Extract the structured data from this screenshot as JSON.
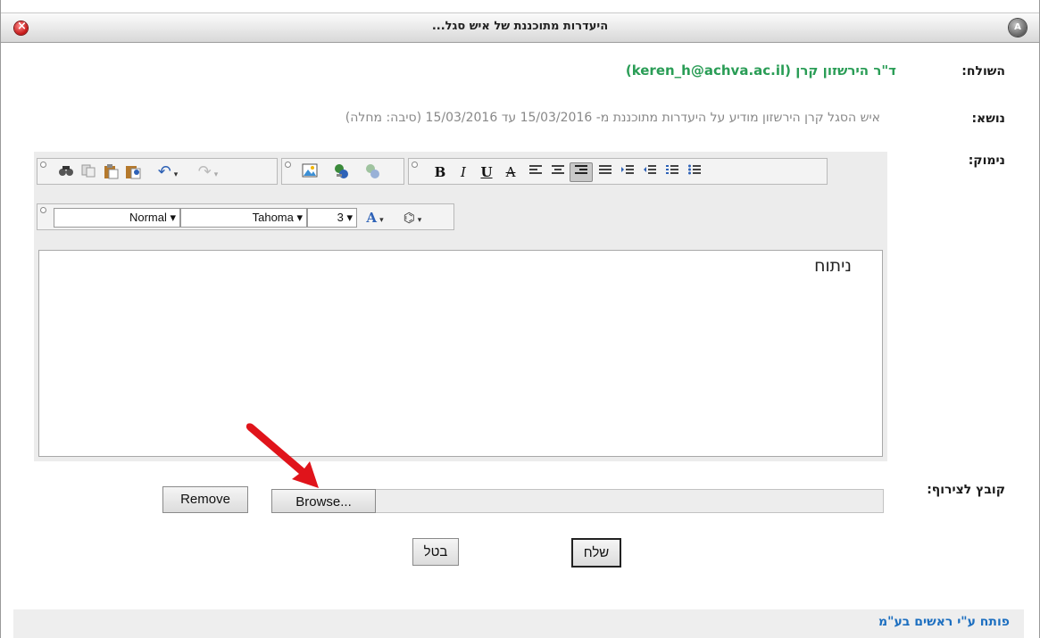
{
  "dialog": {
    "title": "היעדרות מתוכננת של איש סגל...",
    "app_icon_label": "A"
  },
  "form": {
    "sender_label": "השולח:",
    "sender_value": "ד\"ר הירשזון קרן (keren_h@achva.ac.il)",
    "subject_label": "נושא:",
    "subject_value": "איש הסגל קרן הירשזון מודיע על היעדרות מתוכננת מ- 15/03/2016 עד 15/03/2016 (סיבה: מחלה)",
    "reason_label": "נימוק:",
    "attachment_label": "קובץ לצירוף:"
  },
  "editor": {
    "content": "ניתוח",
    "paragraph_style": "Normal",
    "font_family": "Tahoma",
    "font_size": "3",
    "toolbar1_icons": [
      "find-icon",
      "copy-icon",
      "paste-icon",
      "paste-word-icon",
      "undo-icon",
      "redo-icon",
      "image-icon",
      "link-icon",
      "unlink-icon",
      "bold-icon",
      "italic-icon",
      "underline-icon",
      "strikethrough-icon",
      "align-left-icon",
      "align-center-icon",
      "align-right-icon",
      "justify-icon",
      "indent-icon",
      "outdent-icon",
      "ordered-list-icon",
      "unordered-list-icon"
    ]
  },
  "buttons": {
    "remove": "Remove",
    "browse": "Browse...",
    "cancel": "בטל",
    "send": "שלח"
  },
  "footer": {
    "link": "פותח ע\"י ראשים בע\"מ"
  },
  "colors": {
    "sender_green": "#2a9d56",
    "footer_link_blue": "#1d6fc0",
    "arrow_red": "#e0141b"
  }
}
